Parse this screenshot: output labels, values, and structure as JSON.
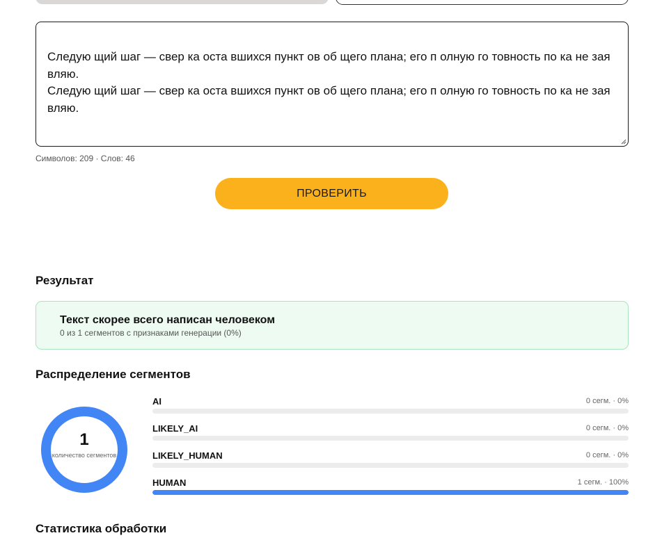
{
  "input": {
    "text_lines": [
      "Следую щий шаг — свер ка оста вшихся пункт ов об щего плана; его п олную го товность по ка не зая вляю.",
      "Следую щий шаг — свер ка оста вшихся пункт ов об щего плана; его п олную го товность по ка не зая вляю."
    ],
    "counter": "Символов: 209 · Слов: 46"
  },
  "check_button": {
    "label": "ПРОВЕРИТЬ"
  },
  "result": {
    "section_title": "Результат",
    "verdict": "Текст скорее всего написан человеком",
    "details": "0 из 1 сегментов с признаками генерации (0%)"
  },
  "distribution": {
    "section_title": "Распределение сегментов",
    "total": "1",
    "total_caption": "количество сегментов",
    "accent_color": "#4285f4",
    "rows": [
      {
        "label": "AI",
        "meta": "0 сегм. · 0%",
        "share": 0
      },
      {
        "label": "LIKELY_AI",
        "meta": "0 сегм. · 0%",
        "share": 0
      },
      {
        "label": "LIKELY_HUMAN",
        "meta": "0 сегм. · 0%",
        "share": 0
      },
      {
        "label": "HUMAN",
        "meta": "1 сегм. · 100%",
        "share": 1
      }
    ]
  },
  "stats": {
    "section_title": "Статистика обработки"
  }
}
